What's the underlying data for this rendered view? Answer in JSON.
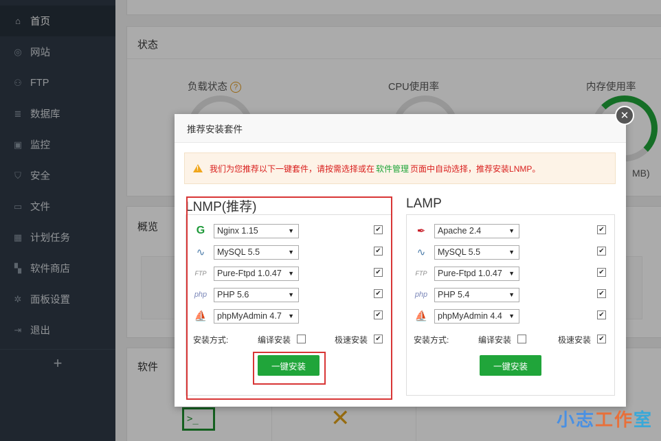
{
  "sidebar": {
    "items": [
      {
        "label": "首页",
        "icon": "home-icon",
        "glyph": "⌂"
      },
      {
        "label": "网站",
        "icon": "globe-icon",
        "glyph": "◎"
      },
      {
        "label": "FTP",
        "icon": "ftp-icon",
        "glyph": "⚇"
      },
      {
        "label": "数据库",
        "icon": "database-icon",
        "glyph": "≣"
      },
      {
        "label": "监控",
        "icon": "monitor-icon",
        "glyph": "▣"
      },
      {
        "label": "安全",
        "icon": "shield-icon",
        "glyph": "⛉"
      },
      {
        "label": "文件",
        "icon": "folder-icon",
        "glyph": "▭"
      },
      {
        "label": "计划任务",
        "icon": "calendar-icon",
        "glyph": "▦"
      },
      {
        "label": "软件商店",
        "icon": "apps-icon",
        "glyph": "▚"
      },
      {
        "label": "面板设置",
        "icon": "gear-icon",
        "glyph": "✲"
      },
      {
        "label": "退出",
        "icon": "logout-icon",
        "glyph": "⇥"
      }
    ],
    "add_glyph": "+"
  },
  "dashboard": {
    "status_title": "状态",
    "load_label": "负载状态",
    "help_glyph": "?",
    "cpu_label": "CPU使用率",
    "mem_label": "内存使用率",
    "mem_value_fragment": "MB)",
    "overview_title": "概览",
    "software_title": "软件"
  },
  "modal": {
    "title": "推荐安装套件",
    "close_glyph": "✕",
    "alert_prefix": "我们为您推荐以下一键套件，请按需选择或在",
    "alert_link": "软件管理",
    "alert_suffix": "页面中自动选择，推荐安装LNMP。",
    "lnmp": {
      "title": "LNMP(推荐)",
      "rows": [
        {
          "icon": "nginx-icon",
          "glyph": "G",
          "value": "Nginx 1.15",
          "checked": true
        },
        {
          "icon": "mysql-icon",
          "glyph": "∿",
          "value": "MySQL 5.5",
          "checked": true
        },
        {
          "icon": "ftp-logo-icon",
          "glyph": "FTP",
          "value": "Pure-Ftpd 1.0.47",
          "checked": true
        },
        {
          "icon": "php-icon",
          "glyph": "php",
          "value": "PHP 5.6",
          "checked": true
        },
        {
          "icon": "phpmyadmin-icon",
          "glyph": "⛵",
          "value": "phpMyAdmin 4.7",
          "checked": true
        }
      ],
      "method_label": "安装方式:",
      "compile_label": "编译安装",
      "compile_checked": false,
      "fast_label": "极速安装",
      "fast_checked": true,
      "install_label": "一键安装"
    },
    "lamp": {
      "title": "LAMP",
      "rows": [
        {
          "icon": "apache-icon",
          "glyph": "✒",
          "value": "Apache 2.4",
          "checked": true
        },
        {
          "icon": "mysql-icon",
          "glyph": "∿",
          "value": "MySQL 5.5",
          "checked": true
        },
        {
          "icon": "ftp-logo-icon",
          "glyph": "FTP",
          "value": "Pure-Ftpd 1.0.47",
          "checked": true
        },
        {
          "icon": "php-icon",
          "glyph": "php",
          "value": "PHP 5.4",
          "checked": true
        },
        {
          "icon": "phpmyadmin-icon",
          "glyph": "⛵",
          "value": "phpMyAdmin 4.4",
          "checked": true
        }
      ],
      "method_label": "安装方式:",
      "compile_label": "编译安装",
      "compile_checked": false,
      "fast_label": "极速安装",
      "fast_checked": true,
      "install_label": "一键安装"
    }
  },
  "watermark": {
    "part1": "小志",
    "part2": "工作",
    "part3": "室"
  },
  "colors": {
    "accent": "#20a53a",
    "alert_text": "#d9201e",
    "highlight": "#d83535",
    "sidebar": "#2f3a47"
  }
}
